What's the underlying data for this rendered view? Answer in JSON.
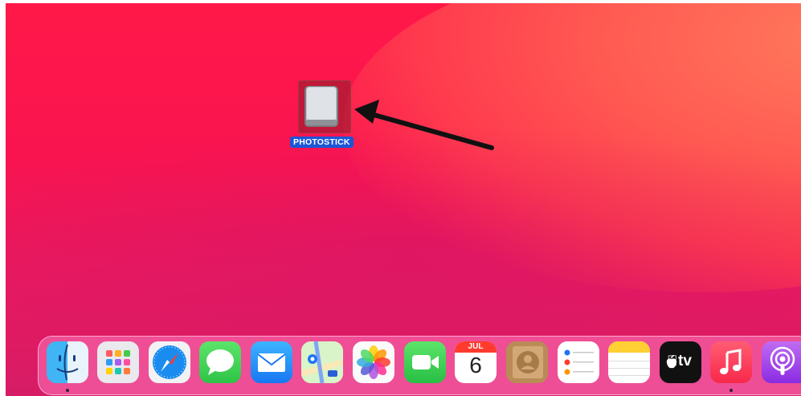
{
  "desktop": {
    "drive_label": "PHOTOSTICK"
  },
  "dock": {
    "apps": [
      "Finder",
      "Launchpad",
      "Safari",
      "Messages",
      "Mail",
      "Maps",
      "Photos",
      "FaceTime",
      "Calendar",
      "Contacts",
      "Reminders",
      "Notes",
      "TV",
      "Music",
      "Podcasts"
    ],
    "calendar_month": "JUL",
    "calendar_day": "6",
    "tv_label": "tv"
  },
  "colors": {
    "selection": "#1c56d6",
    "wallpaper": "#ff1848"
  }
}
